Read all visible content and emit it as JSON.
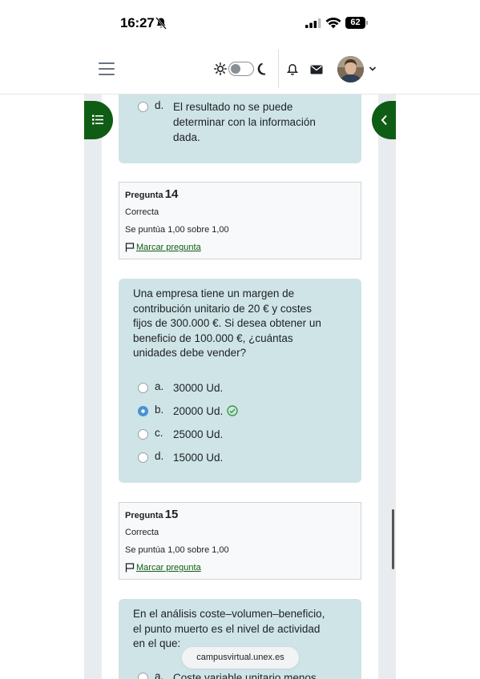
{
  "status_bar": {
    "time": "16:27",
    "battery": "62"
  },
  "navbar": {
    "menu_icon": "hamburger-icon",
    "theme_icons": [
      "sun-icon",
      "moon-icon"
    ],
    "notification_icon": "bell-icon",
    "messages_icon": "mail-icon"
  },
  "prev_question": {
    "answer_d": {
      "letter": "d.",
      "line1": "El resultado no se puede",
      "line2": "determinar con la información",
      "line3": "dada."
    }
  },
  "q14": {
    "label": "Pregunta",
    "number": "14",
    "state": "Correcta",
    "mark": "Se puntúa 1,00 sobre 1,00",
    "flag": "Marcar pregunta",
    "text_lines": [
      "Una empresa tiene un margen de",
      "contribución unitario de 20 € y costes",
      "fijos de 300.000 €. Si desea obtener un",
      "beneficio de 100.000 €, ¿cuántas",
      "unidades debe vender?"
    ],
    "answers": [
      {
        "letter": "a.",
        "text": "30000 Ud."
      },
      {
        "letter": "b.",
        "text": "20000 Ud."
      },
      {
        "letter": "c.",
        "text": "25000 Ud."
      },
      {
        "letter": "d.",
        "text": "15000 Ud."
      }
    ],
    "selected": "b."
  },
  "q15": {
    "label": "Pregunta",
    "number": "15",
    "state": "Correcta",
    "mark": "Se puntúa 1,00 sobre 1,00",
    "flag": "Marcar pregunta",
    "text_lines": [
      "En el análisis coste–volumen–beneficio,",
      "el punto muerto es el nivel de actividad",
      "en el que:"
    ],
    "answer_a_partial": {
      "letter": "a.",
      "text": "Coste variable unitario menos"
    }
  },
  "browser": {
    "url": "campusvirtual.unex.es"
  },
  "colors": {
    "primary_green": "#0f5d14",
    "question_bg": "#cfe4e6",
    "correct_check": "#3a9a3f",
    "radio_selected": "#4a90d9"
  }
}
